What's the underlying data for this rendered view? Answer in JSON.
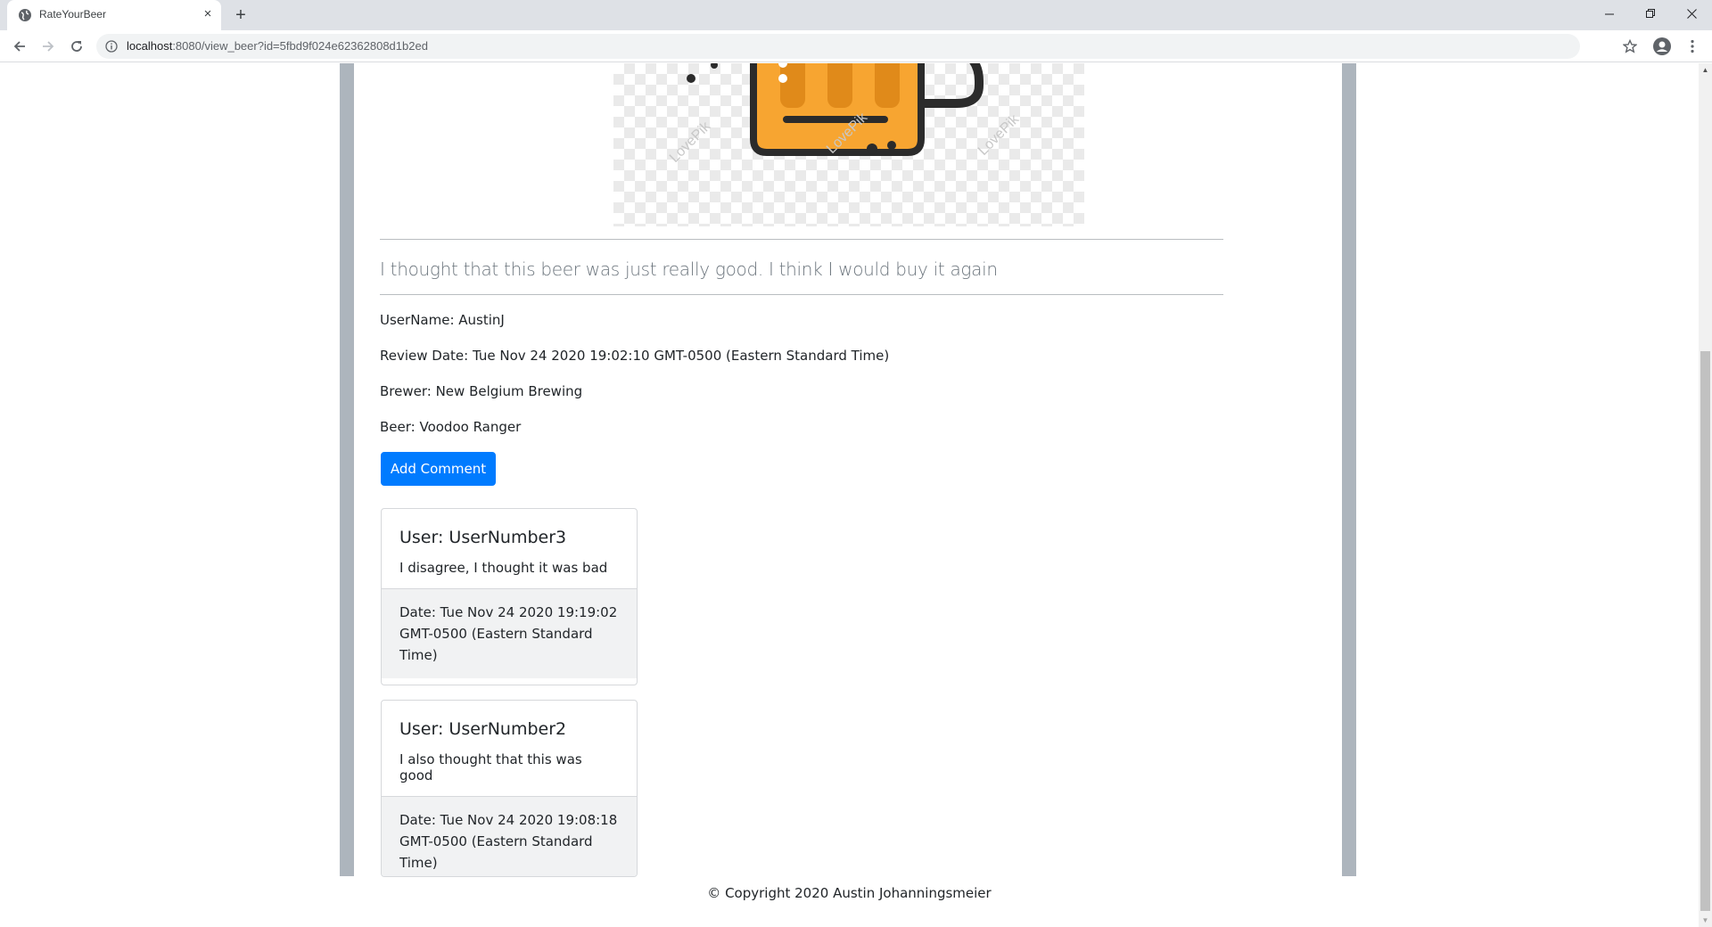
{
  "browser": {
    "tab_title": "RateYourBeer",
    "tab_close": "×",
    "new_tab": "+",
    "url_host": "localhost",
    "url_path": ":8080/view_beer?id=5fbd9f024e62362808d1b2ed"
  },
  "review": {
    "text": "I thought that this beer was just really good. I think I would buy it again",
    "username": "UserName: AustinJ",
    "review_date": "Review Date: Tue Nov 24 2020 19:02:10 GMT-0500 (Eastern Standard Time)",
    "brewer": "Brewer: New Belgium Brewing",
    "beer": "Beer: Voodoo Ranger",
    "add_comment_label": "Add Comment"
  },
  "comments": [
    {
      "user": "User: UserNumber3",
      "text": "I disagree, I thought it was bad",
      "date": "Date: Tue Nov 24 2020 19:19:02 GMT-0500 (Eastern Standard Time)"
    },
    {
      "user": "User: UserNumber2",
      "text": "I also thought that this was good",
      "date": "Date: Tue Nov 24 2020 19:08:18 GMT-0500 (Eastern Standard Time)"
    }
  ],
  "image": {
    "watermark": "LovePik",
    "colors": {
      "beer": "#f7a531",
      "outline": "#2b2b2b"
    }
  },
  "footer": {
    "copyright": "© Copyright 2020 Austin Johanningsmeier"
  },
  "theme": {
    "primary": "#007bff",
    "stripe": "#adb5bd"
  }
}
